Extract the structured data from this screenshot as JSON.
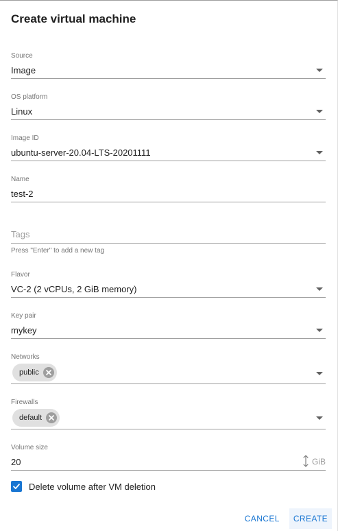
{
  "dialog": {
    "title": "Create virtual machine"
  },
  "fields": {
    "source": {
      "label": "Source",
      "value": "Image"
    },
    "os_platform": {
      "label": "OS platform",
      "value": "Linux"
    },
    "image_id": {
      "label": "Image ID",
      "value": "ubuntu-server-20.04-LTS-20201111"
    },
    "name": {
      "label": "Name",
      "value": "test-2"
    },
    "tags": {
      "placeholder": "Tags",
      "hint": "Press \"Enter\" to add a new tag"
    },
    "flavor": {
      "label": "Flavor",
      "value": "VC-2 (2 vCPUs, 2 GiB memory)"
    },
    "key_pair": {
      "label": "Key pair",
      "value": "mykey"
    },
    "networks": {
      "label": "Networks",
      "chips": [
        "public"
      ]
    },
    "firewalls": {
      "label": "Firewalls",
      "chips": [
        "default"
      ]
    },
    "volume_size": {
      "label": "Volume size",
      "value": "20",
      "unit": "GiB"
    }
  },
  "delete_volume": {
    "label": "Delete volume after VM deletion",
    "checked": true
  },
  "actions": {
    "cancel": "CANCEL",
    "create": "CREATE"
  },
  "colors": {
    "accent": "#1976d2",
    "chip_bg": "#e0e0e0",
    "underline": "#9e9e9e"
  },
  "icons": {
    "select": "chevron-down-icon",
    "chip_remove": "close-circle-icon",
    "stepper": "up-down-arrow-icon",
    "checkbox": "check-icon"
  }
}
